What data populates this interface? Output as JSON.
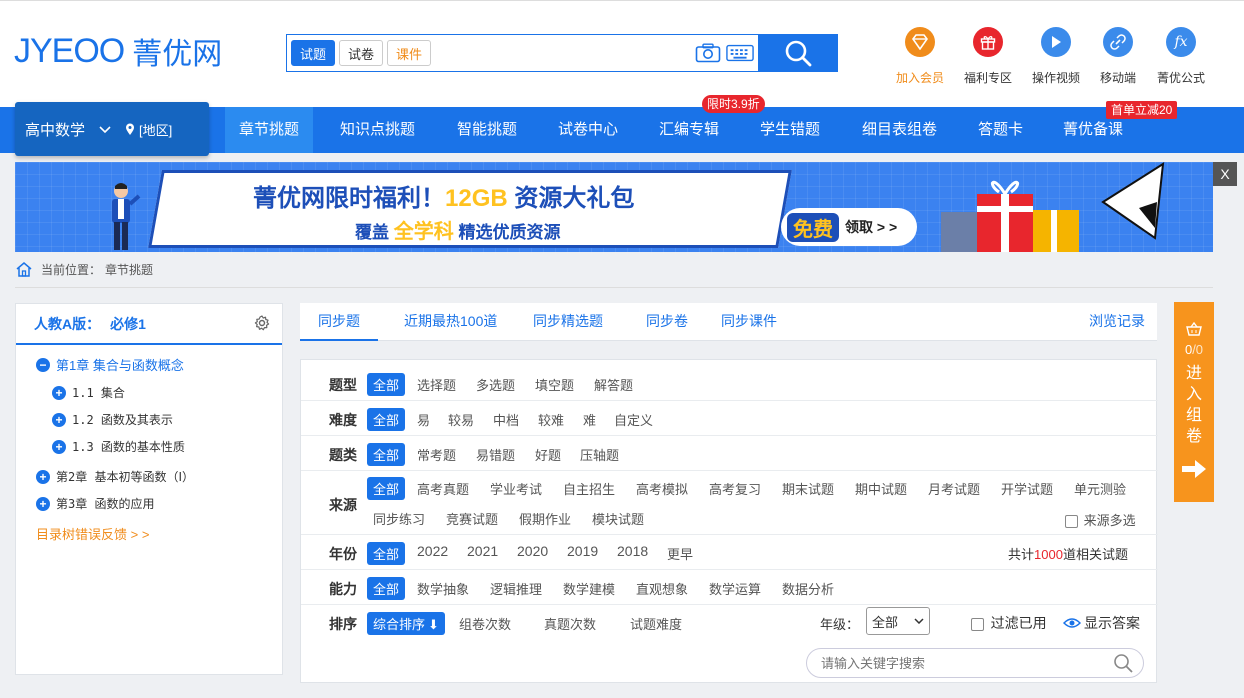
{
  "logo": {
    "en": "JYEOO",
    "cn": "菁优网"
  },
  "search": {
    "tabs": [
      "试题",
      "试卷",
      "课件"
    ],
    "placeholder": ""
  },
  "quick_links": [
    {
      "label": "加入会员",
      "icon": "vip-diamond-icon",
      "color": "#f08c1b"
    },
    {
      "label": "福利专区",
      "icon": "gift-icon",
      "color": "#e8262d"
    },
    {
      "label": "操作视频",
      "icon": "play-icon",
      "color": "#3b8beb"
    },
    {
      "label": "移动端",
      "icon": "mobile-link-icon",
      "color": "#3b8beb"
    },
    {
      "label": "菁优公式",
      "icon": "formula-icon",
      "color": "#3b8beb"
    }
  ],
  "nav": {
    "subject": "高中数学",
    "region": "[地区]",
    "items": [
      "章节挑题",
      "知识点挑题",
      "智能挑题",
      "试卷中心",
      "汇编专辑",
      "学生错题",
      "细目表组卷",
      "答题卡",
      "菁优备课"
    ],
    "badge_sale": "限时3.9折",
    "badge_first": "首单立减20"
  },
  "banner": {
    "title_a": "菁优网限时福利！",
    "title_hl": "12GB",
    "title_b": "资源大礼包",
    "sub_a": "覆盖",
    "sub_hl": "全学科",
    "sub_b": "精选优质资源",
    "free": "免费",
    "get": "领取 > >",
    "close": "X"
  },
  "breadcrumb": {
    "prefix": "当前位置：",
    "current": "章节挑题"
  },
  "sidebar": {
    "edition": "人教A版：",
    "book": "必修1",
    "tree": [
      {
        "sign": "−",
        "text": "第1章  集合与函数概念",
        "open": true
      },
      {
        "sign": "+",
        "text": "1.1  集合"
      },
      {
        "sign": "+",
        "text": "1.2  函数及其表示"
      },
      {
        "sign": "+",
        "text": "1.3  函数的基本性质"
      },
      {
        "sign": "+",
        "text": "第2章  基本初等函数（Ⅰ）"
      },
      {
        "sign": "+",
        "text": "第3章  函数的应用"
      }
    ],
    "feedback": "目录树错误反馈 > >"
  },
  "tabs": {
    "items": [
      "同步题",
      "近期最热100道",
      "同步精选题",
      "同步卷",
      "同步课件"
    ],
    "browse": "浏览记录"
  },
  "filters": {
    "type": {
      "label": "题型",
      "options": [
        "全部",
        "选择题",
        "多选题",
        "填空题",
        "解答题"
      ]
    },
    "difficulty": {
      "label": "难度",
      "options": [
        "全部",
        "易",
        "较易",
        "中档",
        "较难",
        "难",
        "自定义"
      ]
    },
    "category": {
      "label": "题类",
      "options": [
        "全部",
        "常考题",
        "易错题",
        "好题",
        "压轴题"
      ]
    },
    "source": {
      "label": "来源",
      "options": [
        "全部",
        "高考真题",
        "学业考试",
        "自主招生",
        "高考模拟",
        "高考复习",
        "期末试题",
        "期中试题",
        "月考试题",
        "开学试题",
        "单元测验",
        "同步练习",
        "竞赛试题",
        "假期作业",
        "模块试题"
      ],
      "multi": "来源多选"
    },
    "year": {
      "label": "年份",
      "options": [
        "全部",
        "2022",
        "2021",
        "2020",
        "2019",
        "2018",
        "更早"
      ],
      "total_pre": "共计",
      "total": "1000",
      "total_post": "道相关试题"
    },
    "ability": {
      "label": "能力",
      "options": [
        "全部",
        "数学抽象",
        "逻辑推理",
        "数学建模",
        "直观想象",
        "数学运算",
        "数据分析"
      ]
    },
    "sort": {
      "label": "排序",
      "options": [
        "综合排序",
        "组卷次数",
        "真题次数",
        "试题难度"
      ],
      "grade_label": "年级：",
      "grade_value": "全部",
      "filter_used": "过滤已用",
      "show_answer": "显示答案"
    },
    "keyword_placeholder": "请输入关键字搜索"
  },
  "float_cart": {
    "count_used": "0",
    "count_total": "/0",
    "label": "进入组卷"
  }
}
